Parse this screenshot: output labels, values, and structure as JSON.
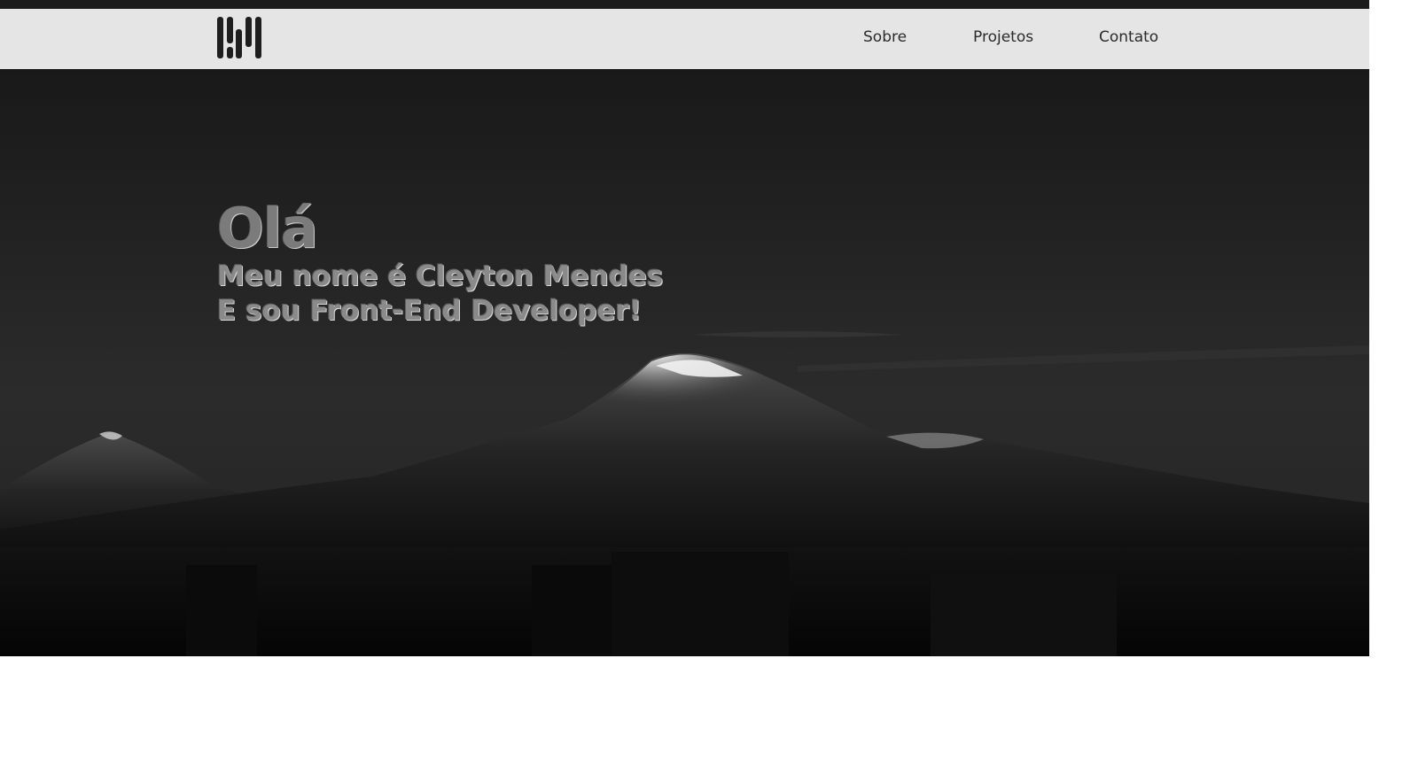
{
  "nav": {
    "logo_icon": "brand-logo-icon",
    "links": [
      "Sobre",
      "Projetos",
      "Contato"
    ]
  },
  "hero": {
    "greeting": "Olá",
    "line1": "Meu nome é Cleyton Mendes",
    "line2": "E sou Front-End Developer!",
    "background": "mountain-landscape-photo"
  },
  "colors": {
    "navbar": "#e5e5e5",
    "hero_text": "#7b7b7b",
    "hero_bg": "#1e1e1e"
  }
}
